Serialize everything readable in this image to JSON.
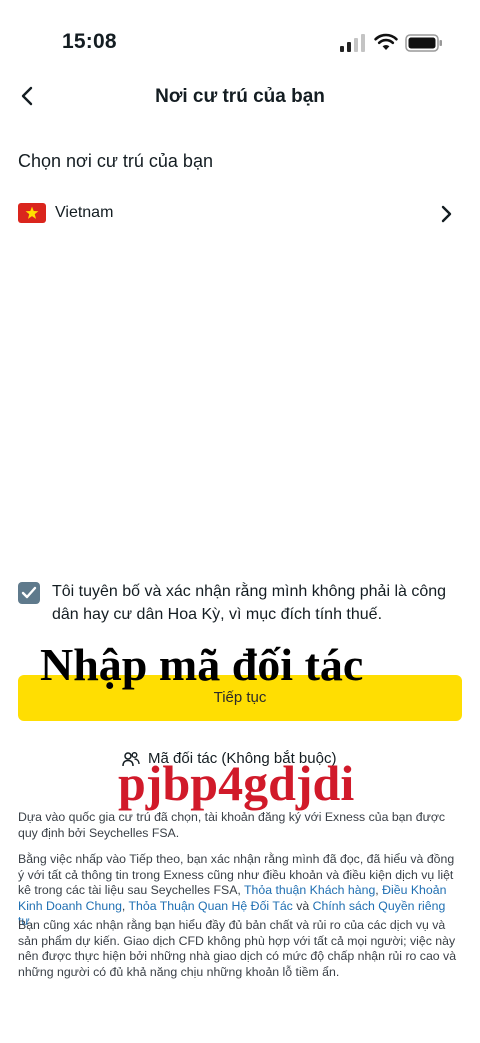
{
  "status_bar": {
    "time": "15:08"
  },
  "header": {
    "title": "Nơi cư trú của bạn"
  },
  "subtitle": "Chọn nơi cư trú của bạn",
  "country": {
    "name": "Vietnam",
    "flag": "vietnam-flag-icon"
  },
  "declaration": {
    "checked": true,
    "text": "Tôi tuyên bố và xác nhận rằng mình không phải là công dân hay cư dân Hoa Kỳ, vì mục đích tính thuế."
  },
  "overlay": {
    "heading": "Nhập mã đối tác",
    "code": "pjbp4gdjdi"
  },
  "continue_button": {
    "label": "Tiếp tục"
  },
  "partner_code": {
    "label": "Mã đối tác (Không bắt buộc)"
  },
  "legal": {
    "p1": "Dựa vào quốc gia cư trú đã chọn, tài khoản đăng ký với Exness của bạn được quy định bởi Seychelles FSA.",
    "p2_prefix": "Bằng việc nhấp vào Tiếp theo, bạn xác nhận rằng mình đã đọc, đã hiểu và đồng ý với tất cả thông tin trong Exness cũng như điều khoản và điều kiện dịch vụ liệt kê trong các tài liệu sau Seychelles FSA, ",
    "link_client": "Thỏa thuận Khách hàng",
    "sep1": ", ",
    "link_general": "Điều Khoản Kinh Doanh Chung",
    "sep2": ", ",
    "link_partner": "Thỏa Thuận Quan Hệ Đối Tác",
    "and": " và ",
    "link_privacy": "Chính sách Quyền riêng tư",
    "end": ".",
    "p3": "Bạn cũng xác nhận rằng bạn hiểu đầy đủ bản chất và rủi ro của các dịch vụ và sản phẩm dự kiến. Giao dịch CFD không phù hợp với tất cả mọi người; việc này nên được thực hiện bởi những nhà giao dịch có mức độ chấp nhận rủi ro cao và những người có đủ khả năng chịu những khoản lỗ tiềm ẩn."
  },
  "colors": {
    "accent": "#ffde02",
    "link": "#1f6fb2",
    "checkbox": "#5f7a8c",
    "overlay_code": "#d11a2a"
  }
}
